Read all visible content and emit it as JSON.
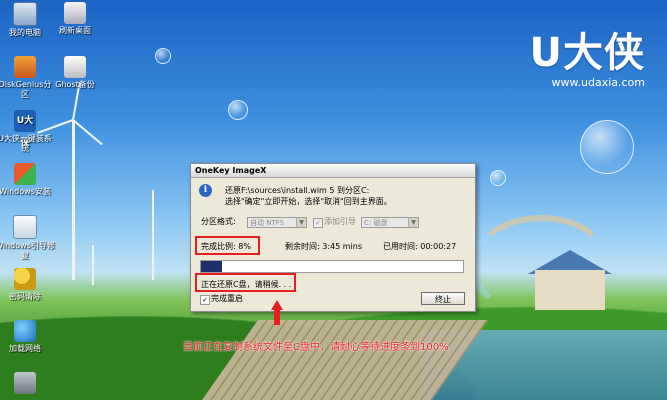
{
  "brand": {
    "logo": "U大侠",
    "url": "www.udaxia.com"
  },
  "desktop_icons": [
    {
      "label": "我的电脑",
      "icon": "computer-icon"
    },
    {
      "label": "刷新桌面",
      "icon": "refresh-icon"
    },
    {
      "label": "DiskGenius分区",
      "icon": "disk-icon"
    },
    {
      "label": "Ghost备份",
      "icon": "ghost-icon"
    },
    {
      "label": "U大侠一键装系统",
      "icon": "u-icon"
    },
    {
      "label": "Windows安装",
      "icon": "windows-icon"
    },
    {
      "label": "Windows引导修复",
      "icon": "windows-repair-icon"
    },
    {
      "label": "密码清除",
      "icon": "key-icon"
    },
    {
      "label": "加载网络",
      "icon": "globe-icon"
    },
    {
      "label": "",
      "icon": "harddisk-icon"
    }
  ],
  "dialog": {
    "title": "OneKey ImageX",
    "message_line1": "还原F:\\sources\\install.wim 5 到分区C:",
    "message_line2": "选择\"确定\"立即开始，选择\"取消\"回到主界面。",
    "partition_format_label": "分区格式:",
    "partition_format_value": "自动 NTFS",
    "add_boot_label": "添加引导",
    "drive_value": "C: 磁盘",
    "progress_label": "完成比例: 8%",
    "progress_percent": 8,
    "remaining_time": "剩余时间: 3:45 mins",
    "elapsed_time": "已用时间: 00:00:27",
    "status_text": "正在还原C盘，请稍候. . .",
    "restart_label": "完成重启",
    "abort_button": "终止"
  },
  "annotation": {
    "note": "目前正在复制系统文件至C盘中，请耐心等待进度条到100%"
  },
  "colors": {
    "highlight_red": "#e52020",
    "progress_fill": "#1f2f6e",
    "dialog_bg": "#ece9d8"
  }
}
